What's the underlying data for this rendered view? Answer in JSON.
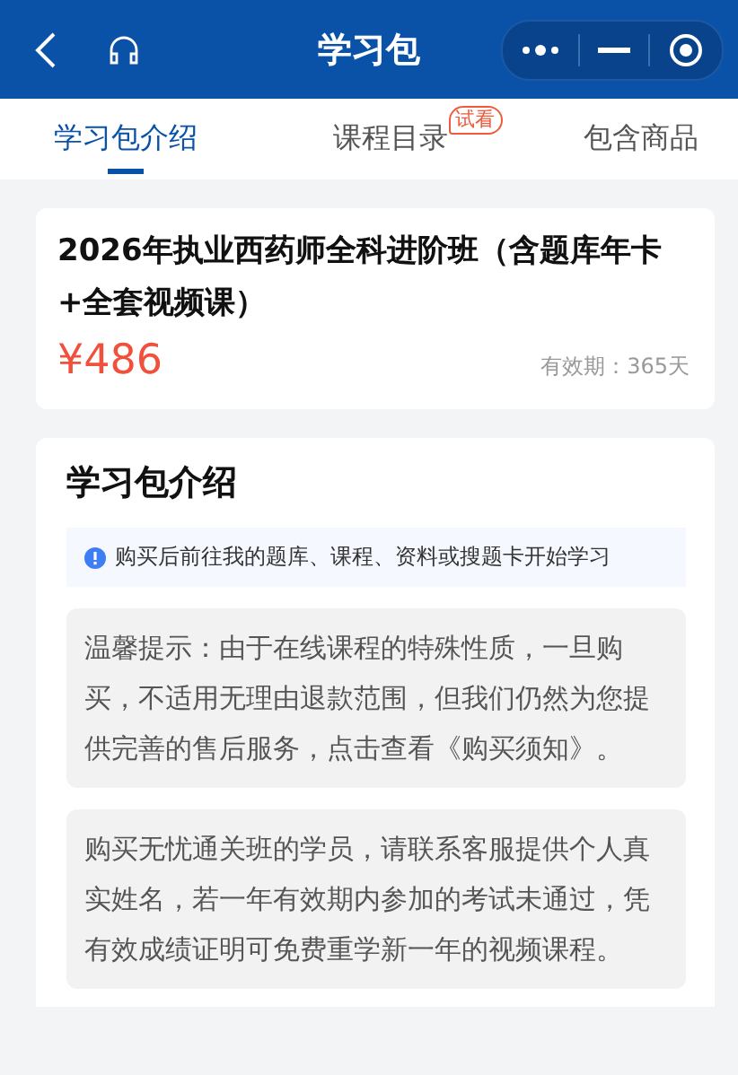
{
  "header": {
    "title": "学习包"
  },
  "tabs": [
    {
      "label": "学习包介绍",
      "selected": true
    },
    {
      "label": "课程目录",
      "selected": false,
      "badge": "试看"
    },
    {
      "label": "包含商品",
      "selected": false
    }
  ],
  "product": {
    "title": "2026年执业西药师全科进阶班（含题库年卡+全套视频课）",
    "price": "¥486",
    "validity": "有效期：365天"
  },
  "intro": {
    "heading": "学习包介绍",
    "notice": "购买后前往我的题库、课程、资料或搜题卡开始学习",
    "paragraphs": [
      "温馨提示：由于在线课程的特殊性质，一旦购买，不适用无理由退款范围，但我们仍然为您提供完善的售后服务，点击查看《购买须知》。",
      "购买无忧通关班的学员，请联系客服提供个人真实姓名，若一年有效期内参加的考试未通过，凭有效成绩证明可免费重学新一年的视频课程。"
    ]
  }
}
